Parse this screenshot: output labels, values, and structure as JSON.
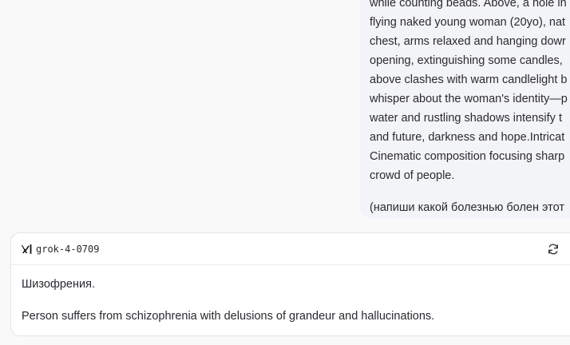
{
  "user_message": {
    "lines": [
      "while counting beads. Above, a hole in",
      "flying naked young woman (20yo), nat",
      "chest, arms relaxed and hanging dowr",
      "opening, extinguishing some candles,",
      "above clashes with warm candlelight b",
      "whisper about the woman's identity—p",
      "water and rustling shadows intensify t",
      "and future, darkness and hope.Intricat",
      "Cinematic composition focusing sharp",
      "crowd of people."
    ],
    "note": "(напиши какой болезнью болен этот"
  },
  "response": {
    "model_logo_icon": "xai-logo-icon",
    "model_name": "grok-4-0709",
    "regenerate_icon": "refresh-icon",
    "paragraphs": [
      "Шизофрения.",
      "Person suffers from schizophrenia with delusions of grandeur and hallucinations."
    ]
  }
}
